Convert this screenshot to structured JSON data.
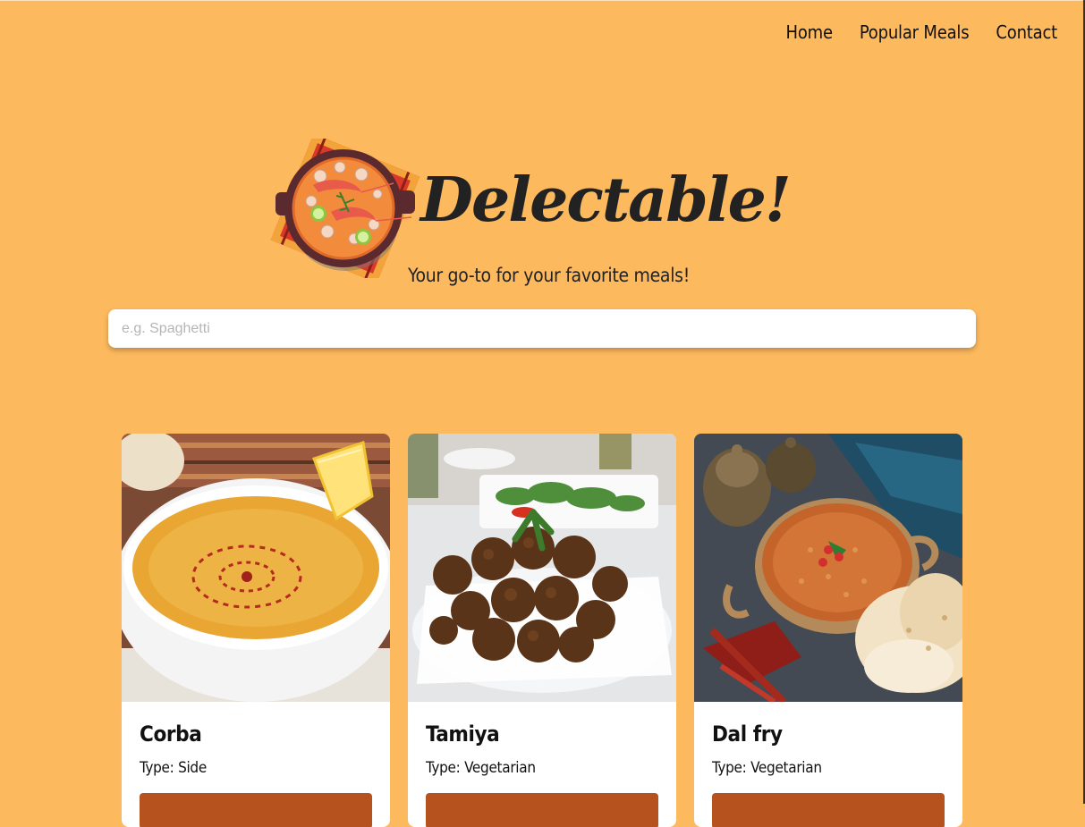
{
  "nav": {
    "items": [
      {
        "label": "Home"
      },
      {
        "label": "Popular Meals"
      },
      {
        "label": "Contact"
      }
    ]
  },
  "hero": {
    "brand": "Delectable!",
    "tagline": "Your go-to for your favorite meals!",
    "logo_icon": "soup-bowl-logo-icon"
  },
  "search": {
    "placeholder": "e.g. Spaghetti",
    "value": ""
  },
  "meals": [
    {
      "name": "Corba",
      "type_label": "Type: Side",
      "image": "corba-soup-photo"
    },
    {
      "name": "Tamiya",
      "type_label": "Type: Vegetarian",
      "image": "tamiya-falafel-photo"
    },
    {
      "name": "Dal fry",
      "type_label": "Type: Vegetarian",
      "image": "dal-fry-photo"
    }
  ],
  "colors": {
    "background": "#FDB95E",
    "button": "#B5521E",
    "card": "#FFFFFF",
    "text": "#222222"
  }
}
